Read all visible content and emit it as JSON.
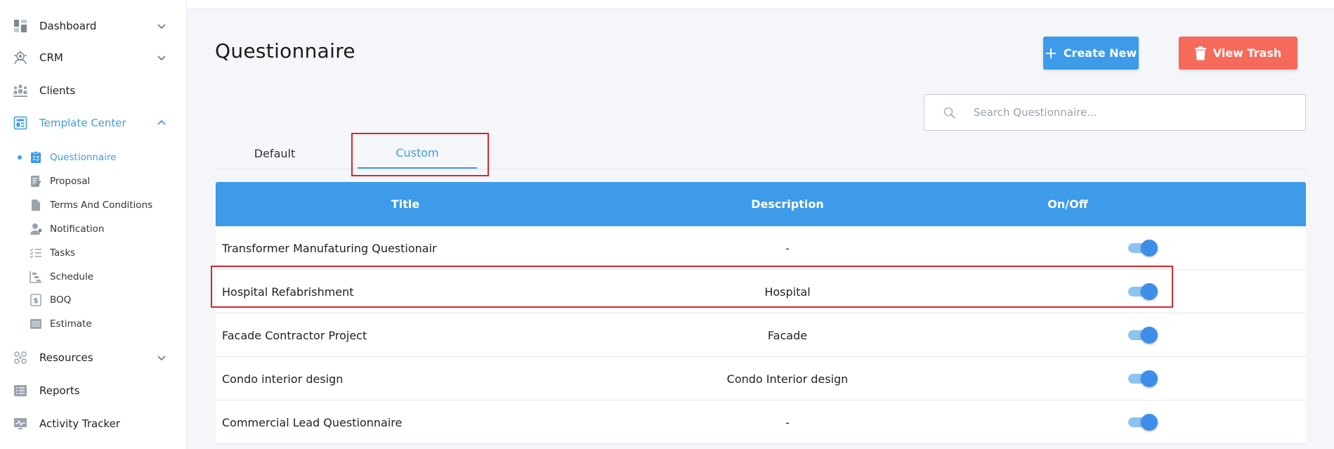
{
  "sidebar": {
    "items": [
      {
        "label": "Dashboard",
        "icon": "dashboard-icon",
        "chevron": "down"
      },
      {
        "label": "CRM",
        "icon": "crm-icon",
        "chevron": "down"
      },
      {
        "label": "Clients",
        "icon": "clients-icon"
      },
      {
        "label": "Template Center",
        "icon": "template-center-icon",
        "chevron": "up",
        "active": true
      },
      {
        "label": "Resources",
        "icon": "resources-icon",
        "chevron": "down"
      },
      {
        "label": "Reports",
        "icon": "reports-icon"
      },
      {
        "label": "Activity Tracker",
        "icon": "activity-tracker-icon"
      }
    ],
    "sub_items": [
      {
        "label": "Questionnaire",
        "icon": "questionnaire-icon",
        "active": true
      },
      {
        "label": "Proposal",
        "icon": "proposal-icon"
      },
      {
        "label": "Terms And Conditions",
        "icon": "document-icon"
      },
      {
        "label": "Notification",
        "icon": "notification-icon"
      },
      {
        "label": "Tasks",
        "icon": "tasks-icon"
      },
      {
        "label": "Schedule",
        "icon": "schedule-icon"
      },
      {
        "label": "BOQ",
        "icon": "boq-icon"
      },
      {
        "label": "Estimate",
        "icon": "estimate-icon"
      }
    ]
  },
  "header": {
    "title": "Questionnaire",
    "create_label": "Create New",
    "trash_label": "View Trash"
  },
  "search": {
    "placeholder": "Search Questionnaire...",
    "value": ""
  },
  "tabs": [
    {
      "label": "Default"
    },
    {
      "label": "Custom",
      "active": true
    }
  ],
  "table": {
    "columns": [
      "Title",
      "Description",
      "On/Off"
    ],
    "rows": [
      {
        "title": "Transformer Manufaturing Questionair",
        "description": "-",
        "enabled": true
      },
      {
        "title": "Hospital Refabrishment",
        "description": "Hospital",
        "enabled": true
      },
      {
        "title": "Facade Contractor Project",
        "description": "Facade",
        "enabled": true
      },
      {
        "title": "Condo interior design",
        "description": "Condo Interior design",
        "enabled": true
      },
      {
        "title": "Commercial Lead Questionnaire",
        "description": "-",
        "enabled": true
      }
    ]
  },
  "colors": {
    "accent": "#3d9be9",
    "danger": "#f56a5b",
    "highlight": "#d9262c"
  }
}
